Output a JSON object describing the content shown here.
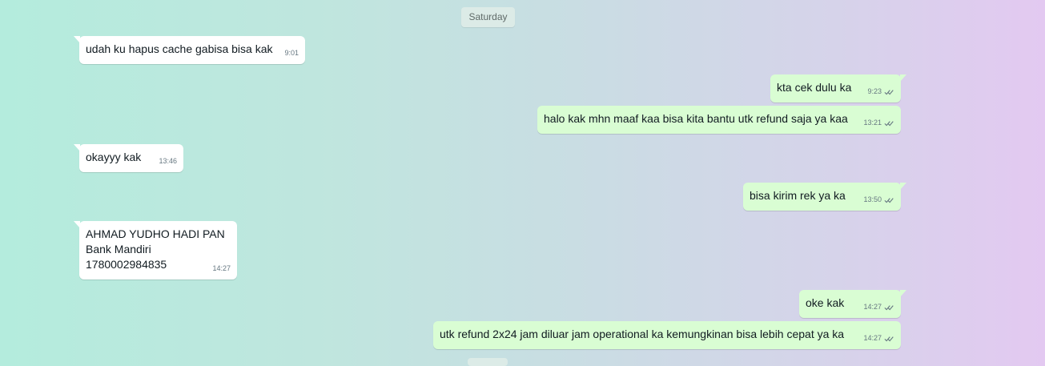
{
  "date_separator": "Saturday",
  "messages": [
    {
      "text": "udah ku hapus cache gabisa bisa kak",
      "time": "9:01"
    },
    {
      "text": "kta cek dulu ka",
      "time": "9:23"
    },
    {
      "text": "halo kak mhn maaf kaa bisa kita bantu utk refund saja ya kaa",
      "time": "13:21"
    },
    {
      "text": "okayyy kak",
      "time": "13:46"
    },
    {
      "text": "bisa kirim rek ya ka",
      "time": "13:50"
    },
    {
      "text": "AHMAD YUDHO HADI PAN\nBank Mandiri\n1780002984835",
      "time": "14:27"
    },
    {
      "text": "oke kak",
      "time": "14:27"
    },
    {
      "text": "utk refund 2x24 jam diluar jam operational ka kemungkinan bisa lebih cepat ya ka",
      "time": "14:27"
    }
  ],
  "icons": {
    "read_receipt": "double-check-icon"
  },
  "colors": {
    "incoming_bubble": "#ffffff",
    "outgoing_bubble": "#d9fdd3",
    "read_tick": "#667781"
  }
}
